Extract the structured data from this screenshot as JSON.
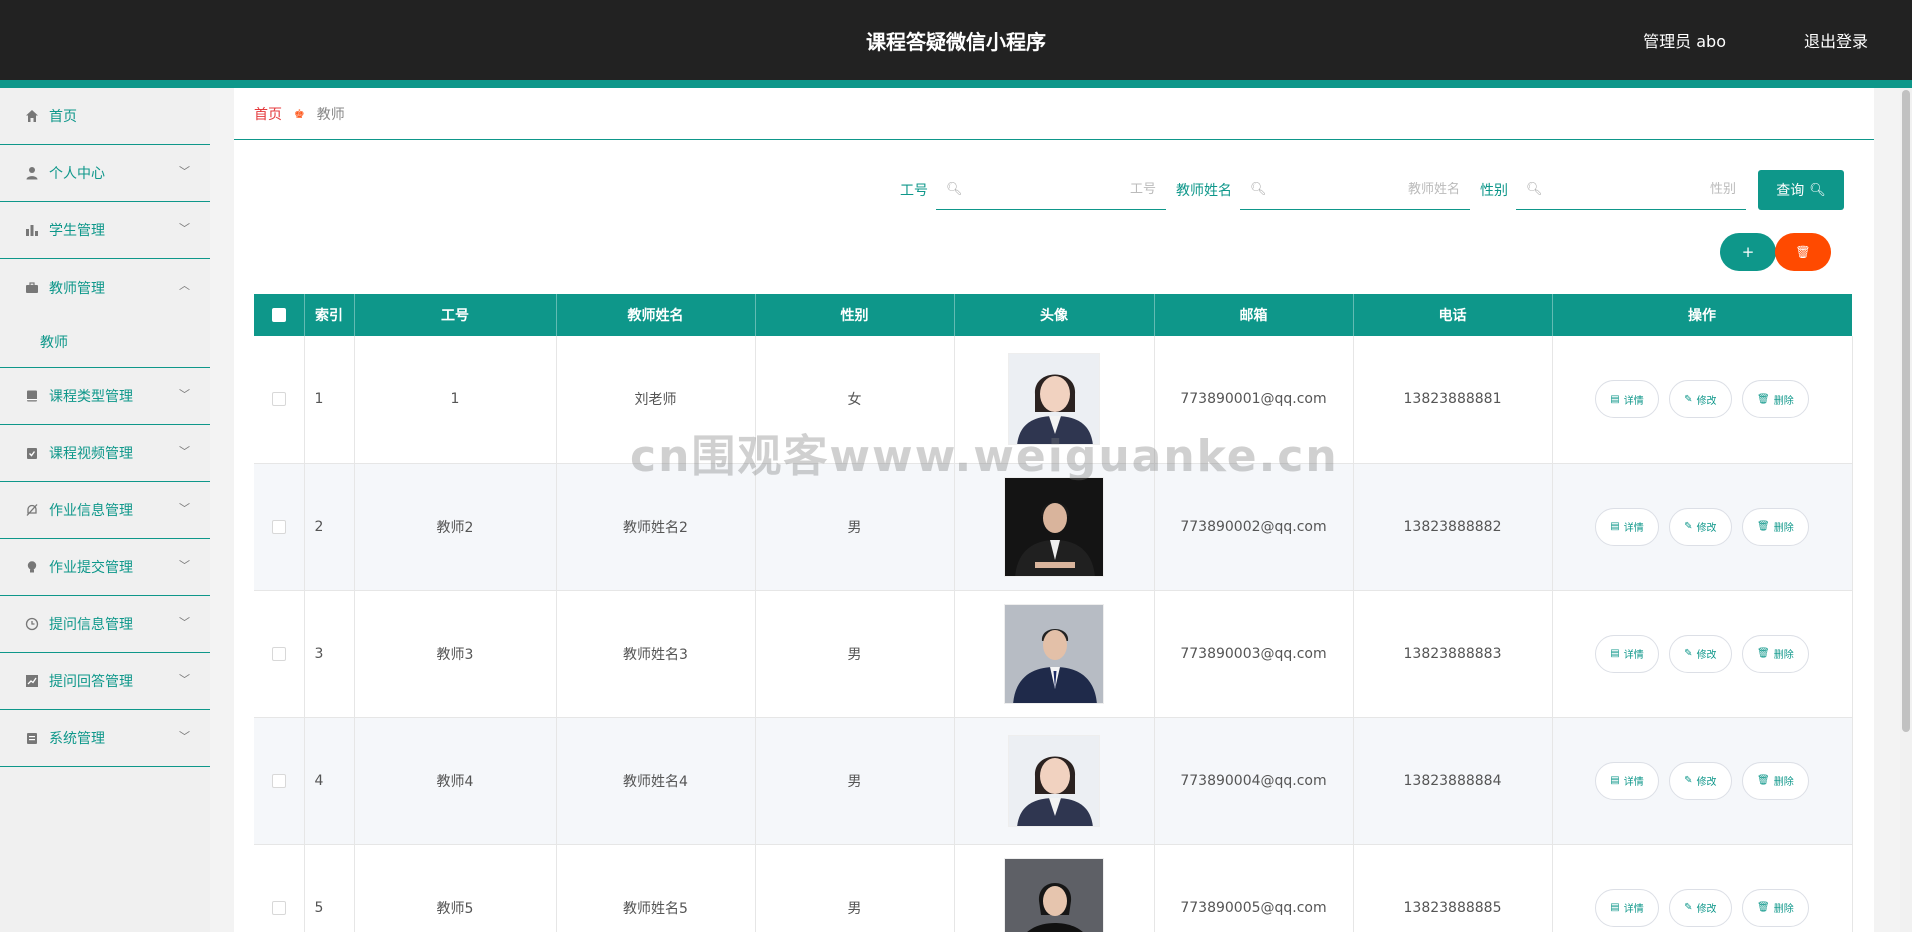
{
  "header": {
    "title": "课程答疑微信小程序",
    "user": "管理员 abo",
    "logout": "退出登录"
  },
  "sidebar": {
    "items": [
      {
        "label": "首页",
        "icon": "home-icon"
      },
      {
        "label": "个人中心",
        "icon": "user-icon"
      },
      {
        "label": "学生管理",
        "icon": "bar-chart-icon"
      },
      {
        "label": "教师管理",
        "icon": "briefcase-icon",
        "expanded": true
      },
      {
        "label": "课程类型管理",
        "icon": "book-icon"
      },
      {
        "label": "课程视频管理",
        "icon": "clipboard-check-icon"
      },
      {
        "label": "作业信息管理",
        "icon": "bell-off-icon"
      },
      {
        "label": "作业提交管理",
        "icon": "bulb-icon"
      },
      {
        "label": "提问信息管理",
        "icon": "clock-icon"
      },
      {
        "label": "提问回答管理",
        "icon": "trend-chart-icon"
      },
      {
        "label": "系统管理",
        "icon": "clipboard-icon"
      }
    ],
    "submenu": "教师"
  },
  "breadcrumb": {
    "home": "首页",
    "current": "教师"
  },
  "search": {
    "f1_label": "工号",
    "f1_placeholder": "工号",
    "f2_label": "教师姓名",
    "f2_placeholder": "教师姓名",
    "f3_label": "性别",
    "f3_placeholder": "性别",
    "query": "查询"
  },
  "actions": {
    "add": "+",
    "delete": "🗑"
  },
  "table": {
    "headers": {
      "index": "索引",
      "id": "工号",
      "name": "教师姓名",
      "gender": "性别",
      "avatar": "头像",
      "email": "邮箱",
      "phone": "电话",
      "ops": "操作"
    },
    "rows": [
      {
        "index": "1",
        "id": "1",
        "name": "刘老师",
        "gender": "女",
        "email": "773890001@qq.com",
        "phone": "13823888881"
      },
      {
        "index": "2",
        "id": "教师2",
        "name": "教师姓名2",
        "gender": "男",
        "email": "773890002@qq.com",
        "phone": "13823888882"
      },
      {
        "index": "3",
        "id": "教师3",
        "name": "教师姓名3",
        "gender": "男",
        "email": "773890003@qq.com",
        "phone": "13823888883"
      },
      {
        "index": "4",
        "id": "教师4",
        "name": "教师姓名4",
        "gender": "男",
        "email": "773890004@qq.com",
        "phone": "13823888884"
      },
      {
        "index": "5",
        "id": "教师5",
        "name": "教师姓名5",
        "gender": "男",
        "email": "773890005@qq.com",
        "phone": "13823888885"
      }
    ],
    "btn_detail": "详情",
    "btn_edit": "修改",
    "btn_delete": "删除"
  },
  "watermark": "cn围观客www.weiguanke.cn",
  "colors": {
    "accent": "#0e978a",
    "danger": "#ff4a00",
    "header_bg": "#222222"
  }
}
